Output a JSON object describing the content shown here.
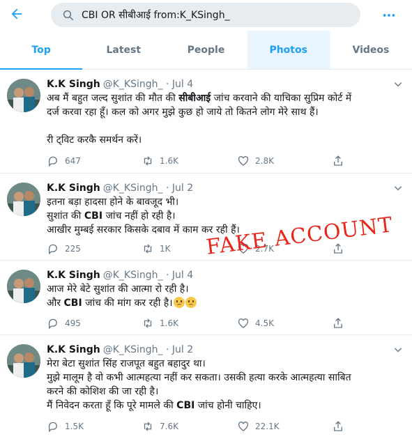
{
  "search": {
    "query": "CBI OR सीबीआई from:K_KSingh_"
  },
  "tabs": [
    {
      "label": "Top"
    },
    {
      "label": "Latest"
    },
    {
      "label": "People"
    },
    {
      "label": "Photos"
    },
    {
      "label": "Videos"
    }
  ],
  "colors": {
    "accent": "#1da1f2",
    "text": "#14171a",
    "muted": "#657786",
    "stamp": "#e8271a"
  },
  "tweets": [
    {
      "name": "K.K Singh",
      "handle": "@K_KSingh_",
      "date": "Jul 4",
      "line1_a": "अब मैं बहुत जल्द सुशांत की मौत की ",
      "line1_b": "सीबीआई",
      "line1_c": " जांच करवाने की याचिका सुप्रिम कोर्ट में",
      "line2": "दर्ज करवा रहा हूँ। कल को अगर मुझे कुछ हो जाये तो कितने लोग मेरे साथ हैं।",
      "line3": "री ट्विट करकै समर्थन करें।",
      "replies": "647",
      "retweets": "1.6K",
      "likes": "2.8K"
    },
    {
      "name": "K.K Singh",
      "handle": "@K_KSingh_",
      "date": "Jul 2",
      "line1": "इतना बड़ा हादसा होने के बावजूद भी।",
      "line2_a": "सुशांत की ",
      "line2_b": "CBI",
      "line2_c": " जांच नहीं हो रही है।",
      "line3": "आखीर मुम्बई सरकार किसके दबाव में काम कर रही हैं।",
      "replies": "225",
      "retweets": "1K",
      "likes": "2.7K"
    },
    {
      "name": "K.K Singh",
      "handle": "@K_KSingh_",
      "date": "Jul 4",
      "line1": "आज मेरे बेटे सुशांत की आत्मा रो रही है।",
      "line2_a": "और ",
      "line2_b": "CBI",
      "line2_c": " जांच की मांग कर रही है।",
      "replies": "495",
      "retweets": "1.6K",
      "likes": "4.5K"
    },
    {
      "name": "K.K Singh",
      "handle": "@K_KSingh_",
      "date": "Jul 2",
      "line1": "मेरा बेटा सुशांत सिंह राजपूत बहुत बहादुर था।",
      "line2": "मुझे मालूम है वो कभी आत्महत्या नहीं कर सकता। उसकी हत्या करके आत्महत्या साबित",
      "line3": "करने की कोशिश की जा रही है।",
      "line4_a": "मैं निवेदन करता हूँ कि पूरे मामले की ",
      "line4_b": "CBI",
      "line4_c": " जांच होनी चाहिए।",
      "replies": "1.5K",
      "retweets": "7.6K",
      "likes": "22.1K"
    }
  ],
  "stamp": "FAKE ACCOUNT"
}
